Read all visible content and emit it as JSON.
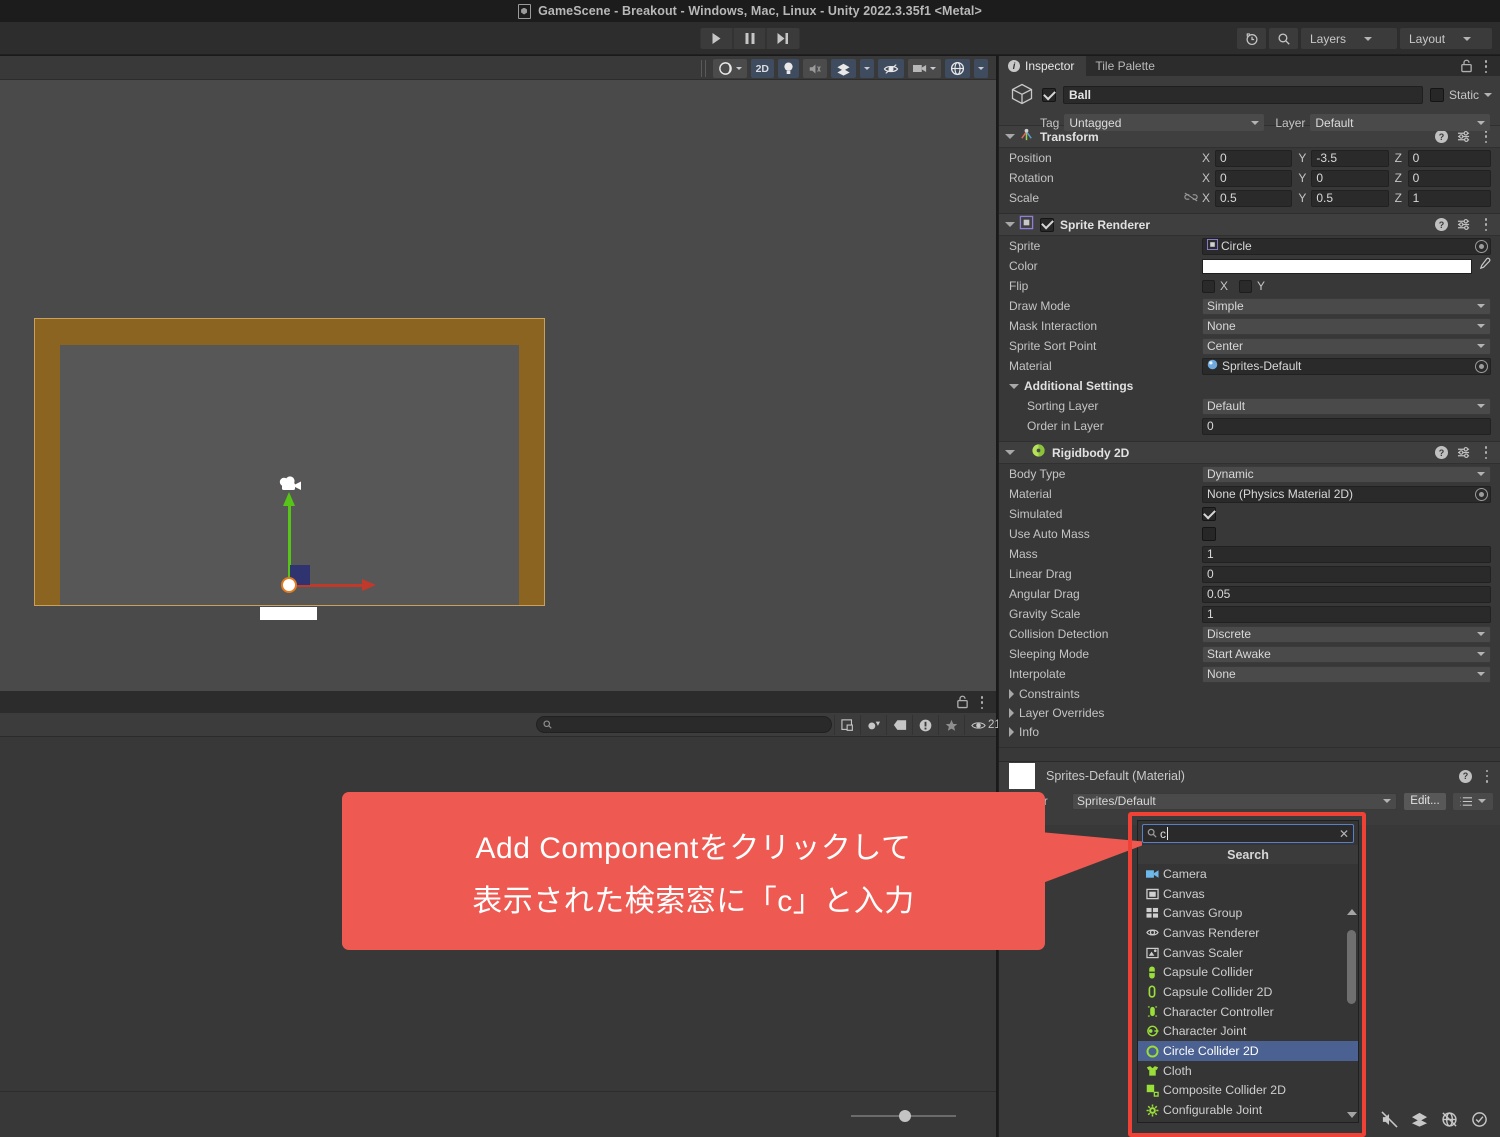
{
  "window": {
    "title": "GameScene - Breakout - Windows, Mac, Linux - Unity 2022.3.35f1 <Metal>",
    "doc_icon": "unity-scene-icon"
  },
  "toolbar": {
    "play_label": "Play",
    "pause_label": "Pause",
    "step_label": "Step",
    "history_icon": "undo-history-icon",
    "search_icon": "search-icon",
    "layers_label": "Layers",
    "layout_label": "Layout"
  },
  "scene_view": {
    "tools": [
      {
        "name": "draw-mode-shaded",
        "label": "",
        "active": false
      },
      {
        "name": "2d-toggle",
        "label": "2D",
        "active": true
      },
      {
        "name": "lighting-toggle",
        "label": "",
        "active": true
      },
      {
        "name": "audio-toggle",
        "label": "",
        "active": false
      },
      {
        "name": "effects-toggle",
        "label": "",
        "active": true
      },
      {
        "name": "hidden-objects-toggle",
        "label": "",
        "active": true
      },
      {
        "name": "camera-settings",
        "label": "",
        "active": false
      },
      {
        "name": "gizmos-toggle",
        "label": "",
        "active": true
      }
    ]
  },
  "project_panel": {
    "search_placeholder": "",
    "visible_count": "21",
    "icons": [
      "save-search-icon",
      "filter-type-icon",
      "filter-label-icon",
      "filter-warning-icon",
      "favorite-icon",
      "eye-icon"
    ]
  },
  "inspector": {
    "tabs": [
      {
        "label": "Inspector",
        "active": true
      },
      {
        "label": "Tile Palette",
        "active": false
      }
    ],
    "lock_icon": "lock-icon",
    "menu_icon": "kebab-menu-icon",
    "game_object": {
      "enabled": true,
      "name": "Ball",
      "static_label": "Static",
      "static_checked": false,
      "tag_label": "Tag",
      "tag_value": "Untagged",
      "layer_label": "Layer",
      "layer_value": "Default"
    },
    "components": [
      {
        "name": "Transform",
        "icon": "transform-icon",
        "expanded": true,
        "rows": [
          {
            "type": "vec3",
            "label": "Position",
            "x": "0",
            "y": "-3.5",
            "z": "0",
            "link": false
          },
          {
            "type": "vec3",
            "label": "Rotation",
            "x": "0",
            "y": "0",
            "z": "0",
            "link": false
          },
          {
            "type": "vec3",
            "label": "Scale",
            "x": "0.5",
            "y": "0.5",
            "z": "1",
            "link": true
          }
        ]
      },
      {
        "name": "Sprite Renderer",
        "icon": "sprite-renderer-icon",
        "expanded": true,
        "enabled": true,
        "rows": [
          {
            "type": "object",
            "label": "Sprite",
            "value": "Circle"
          },
          {
            "type": "color",
            "label": "Color",
            "value": "#ffffff"
          },
          {
            "type": "flip",
            "label": "Flip",
            "x_label": "X",
            "y_label": "Y"
          },
          {
            "type": "dropdown",
            "label": "Draw Mode",
            "value": "Simple"
          },
          {
            "type": "dropdown",
            "label": "Mask Interaction",
            "value": "None"
          },
          {
            "type": "dropdown",
            "label": "Sprite Sort Point",
            "value": "Center"
          },
          {
            "type": "object",
            "label": "Material",
            "value": "Sprites-Default"
          },
          {
            "type": "subheader",
            "label": "Additional Settings"
          },
          {
            "type": "dropdown",
            "label": "Sorting Layer",
            "value": "Default",
            "indent": true
          },
          {
            "type": "text",
            "label": "Order in Layer",
            "value": "0",
            "indent": true
          }
        ]
      },
      {
        "name": "Rigidbody 2D",
        "icon": "rigidbody2d-icon",
        "expanded": true,
        "rows": [
          {
            "type": "dropdown",
            "label": "Body Type",
            "value": "Dynamic"
          },
          {
            "type": "object",
            "label": "Material",
            "value": "None (Physics Material 2D)"
          },
          {
            "type": "checkbox",
            "label": "Simulated",
            "checked": true
          },
          {
            "type": "checkbox",
            "label": "Use Auto Mass",
            "checked": false
          },
          {
            "type": "text",
            "label": "Mass",
            "value": "1"
          },
          {
            "type": "text",
            "label": "Linear Drag",
            "value": "0"
          },
          {
            "type": "text",
            "label": "Angular Drag",
            "value": "0.05"
          },
          {
            "type": "text",
            "label": "Gravity Scale",
            "value": "1"
          },
          {
            "type": "dropdown",
            "label": "Collision Detection",
            "value": "Discrete"
          },
          {
            "type": "dropdown",
            "label": "Sleeping Mode",
            "value": "Start Awake"
          },
          {
            "type": "dropdown",
            "label": "Interpolate",
            "value": "None"
          },
          {
            "type": "foldout",
            "label": "Constraints"
          },
          {
            "type": "foldout",
            "label": "Layer Overrides"
          },
          {
            "type": "foldout",
            "label": "Info"
          }
        ]
      }
    ],
    "material_preview": {
      "title": "Sprites-Default (Material)",
      "shader_label": "Shader",
      "shader_value": "Sprites/Default",
      "edit_label": "Edit..."
    }
  },
  "add_component_popup": {
    "search_value": "c",
    "search_icon": "search-icon",
    "clear_icon": "clear-icon",
    "header_label": "Search",
    "items": [
      {
        "label": "Camera",
        "icon": "camera-icon",
        "color": "#6cb8e8",
        "selected": false
      },
      {
        "label": "Canvas",
        "icon": "canvas-icon",
        "color": "#cfcfcf",
        "selected": false
      },
      {
        "label": "Canvas Group",
        "icon": "canvas-group-icon",
        "color": "#cfcfcf",
        "selected": false
      },
      {
        "label": "Canvas Renderer",
        "icon": "canvas-renderer-icon",
        "color": "#cfcfcf",
        "selected": false
      },
      {
        "label": "Canvas Scaler",
        "icon": "canvas-scaler-icon",
        "color": "#cfcfcf",
        "selected": false
      },
      {
        "label": "Capsule Collider",
        "icon": "capsule-collider-icon",
        "color": "#9ade3a",
        "selected": false
      },
      {
        "label": "Capsule Collider 2D",
        "icon": "capsule-collider-2d-icon",
        "color": "#9ade3a",
        "selected": false
      },
      {
        "label": "Character Controller",
        "icon": "character-controller-icon",
        "color": "#9ade3a",
        "selected": false
      },
      {
        "label": "Character Joint",
        "icon": "character-joint-icon",
        "color": "#9ade3a",
        "selected": false
      },
      {
        "label": "Circle Collider 2D",
        "icon": "circle-collider-2d-icon",
        "color": "#9ade3a",
        "selected": true
      },
      {
        "label": "Cloth",
        "icon": "cloth-icon",
        "color": "#9ade3a",
        "selected": false
      },
      {
        "label": "Composite Collider 2D",
        "icon": "composite-collider-2d-icon",
        "color": "#9ade3a",
        "selected": false
      },
      {
        "label": "Configurable Joint",
        "icon": "configurable-joint-icon",
        "color": "#9ade3a",
        "selected": false
      }
    ]
  },
  "annotation": {
    "highlight_color": "#ef4136",
    "bubble_color": "#ee5a51",
    "line1": "Add Componentをクリックして",
    "line2": "表示された検索窓に「c」と入力"
  },
  "status_bar": {
    "icons": [
      "no-audio-icon",
      "layers-stack-icon",
      "no-gizmos-icon",
      "check-circle-icon"
    ]
  }
}
